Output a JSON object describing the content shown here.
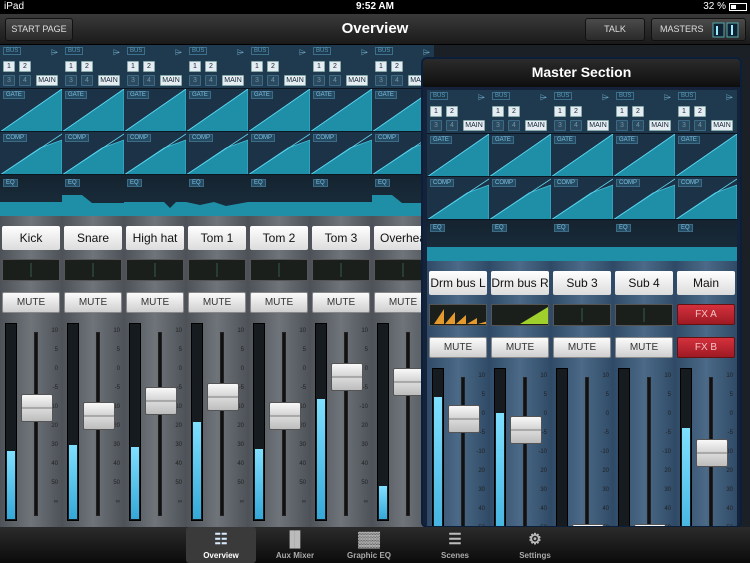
{
  "statusbar": {
    "device": "iPad",
    "time": "9:52 AM",
    "battery": "32 %"
  },
  "topbar": {
    "start_page": "START PAGE",
    "title": "Overview",
    "talk": "TALK",
    "masters": "MASTERS"
  },
  "bus": {
    "label": "BUS",
    "buttons": [
      "1",
      "2",
      "3",
      "4",
      "MAIN"
    ]
  },
  "sections": {
    "gate": "GATE",
    "comp": "COMP",
    "eq": "EQ"
  },
  "mute_label": "MUTE",
  "scale_labels": [
    "10",
    "5",
    "0",
    "-5",
    "-10",
    "20",
    "30",
    "40",
    "50",
    "∞"
  ],
  "channels": [
    {
      "name": "Kick",
      "level": 0.35,
      "fader": 0.6,
      "eq": "flat"
    },
    {
      "name": "Snare",
      "level": 0.38,
      "fader": 0.55,
      "eq": "step"
    },
    {
      "name": "High hat",
      "level": 0.37,
      "fader": 0.65,
      "eq": "notch"
    },
    {
      "name": "Tom 1",
      "level": 0.5,
      "fader": 0.67,
      "eq": "dip"
    },
    {
      "name": "Tom 2",
      "level": 0.36,
      "fader": 0.55,
      "eq": "flat"
    },
    {
      "name": "Tom 3",
      "level": 0.62,
      "fader": 0.8,
      "eq": "flat"
    },
    {
      "name": "Overhea",
      "level": 0.17,
      "fader": 0.77,
      "eq": "step"
    }
  ],
  "master": {
    "title": "Master Section",
    "channels": [
      {
        "name": "Drm bus L",
        "level": 0.86,
        "fader": 0.82,
        "meter": "orange"
      },
      {
        "name": "Drm bus R",
        "level": 0.78,
        "fader": 0.75,
        "meter": "green"
      },
      {
        "name": "Sub 3",
        "level": 0.0,
        "fader": 0.06,
        "meter": "none"
      },
      {
        "name": "Sub 4",
        "level": 0.0,
        "fader": 0.06,
        "meter": "none"
      },
      {
        "name": "Main",
        "level": 0.7,
        "fader": 0.6,
        "meter": "none",
        "fx": [
          "FX A",
          "FX B"
        ]
      }
    ]
  },
  "tabs": [
    {
      "label": "Overview",
      "icon": "overview-icon",
      "active": true
    },
    {
      "label": "Aux Mixer",
      "icon": "aux-mixer-icon",
      "active": false
    },
    {
      "label": "Graphic EQ",
      "icon": "graphic-eq-icon",
      "active": false
    },
    {
      "label": "Scenes",
      "icon": "scenes-icon",
      "active": false
    },
    {
      "label": "Settings",
      "icon": "gear-icon",
      "active": false
    }
  ],
  "colors": {
    "accent": "#35a8d8",
    "teal": "#1f8fa8",
    "fx": "#c52631"
  }
}
